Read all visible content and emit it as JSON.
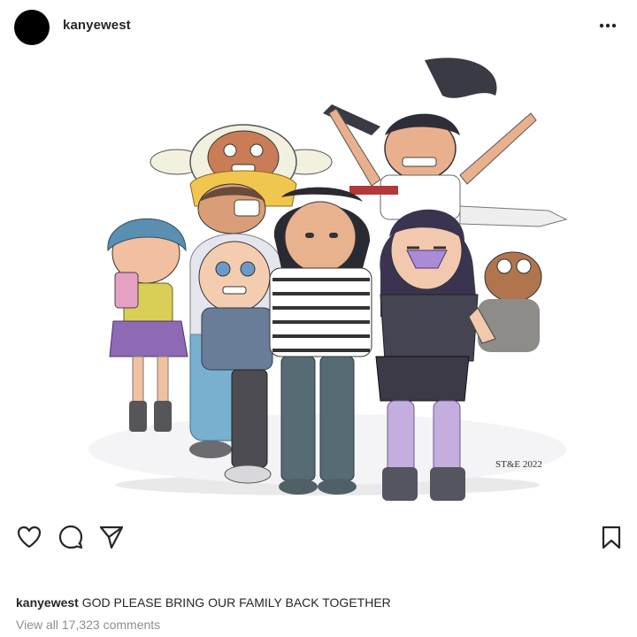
{
  "header": {
    "username": "kanyewest",
    "avatar_color": "#000000"
  },
  "media": {
    "signature": "ST&E 2022"
  },
  "actions": {
    "like_icon": "heart-icon",
    "comment_icon": "comment-icon",
    "share_icon": "send-icon",
    "save_icon": "bookmark-icon",
    "more_icon": "more-dots-icon"
  },
  "caption": {
    "username": "kanyewest",
    "text": "GOD PLEASE BRING OUR FAMILY BACK TOGETHER"
  },
  "comments_link": "View all 17,323 comments",
  "colors": {
    "text": "#262626",
    "muted": "#8e8e8e",
    "background": "#ffffff"
  }
}
